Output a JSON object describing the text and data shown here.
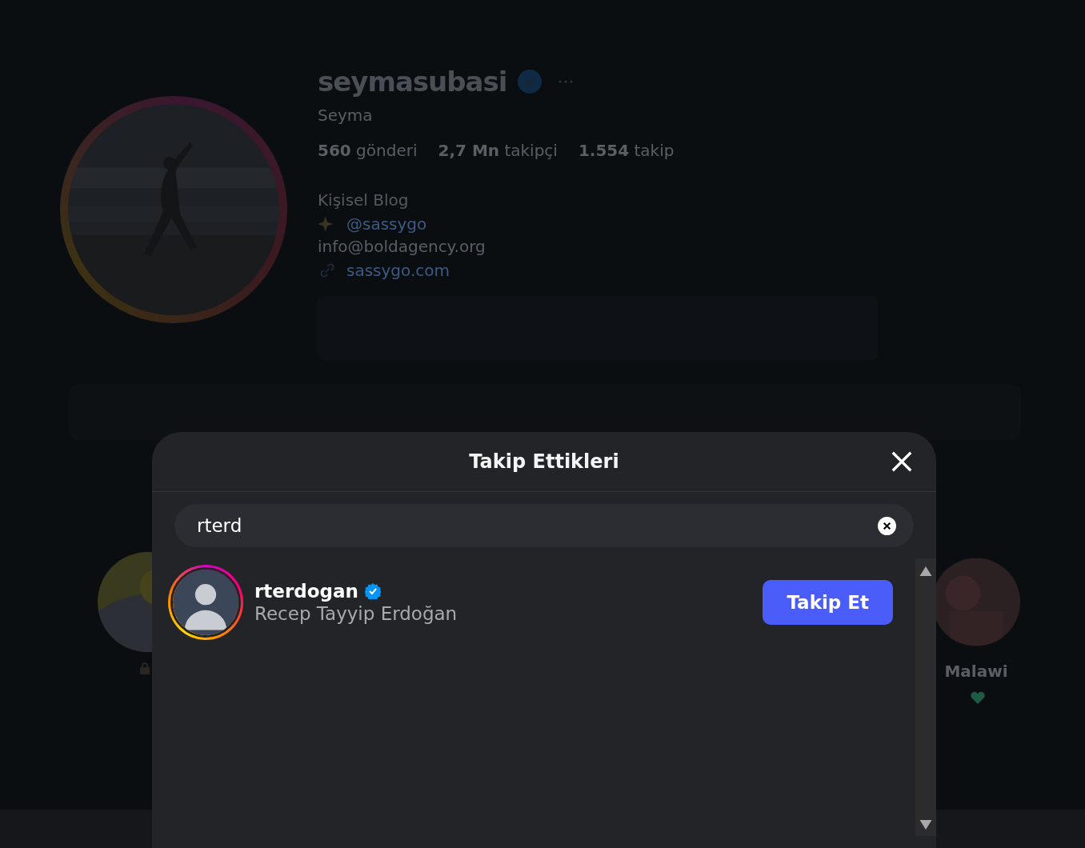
{
  "profile": {
    "username": "seymasubasi",
    "verified": true,
    "display_name": "Seyma",
    "stats": [
      "**560** gönderi",
      "**2,7 Mn** takipçi",
      "**1.554** takip"
    ],
    "category": "Kişisel Blog",
    "mention": "@sassygo",
    "email": "info@boldagency.org",
    "link": "sassygo.com"
  },
  "highlights": [
    {
      "locked": true
    },
    {
      "locked": false,
      "label": "Malawi"
    }
  ],
  "dialog": {
    "title": "Takip Ettikleri",
    "search": {
      "value": "rterd"
    },
    "results": [
      {
        "username": "rterdogan",
        "verified": true,
        "full_name": "Recep Tayyip Erdoğan",
        "button": "Takip Et"
      }
    ]
  }
}
